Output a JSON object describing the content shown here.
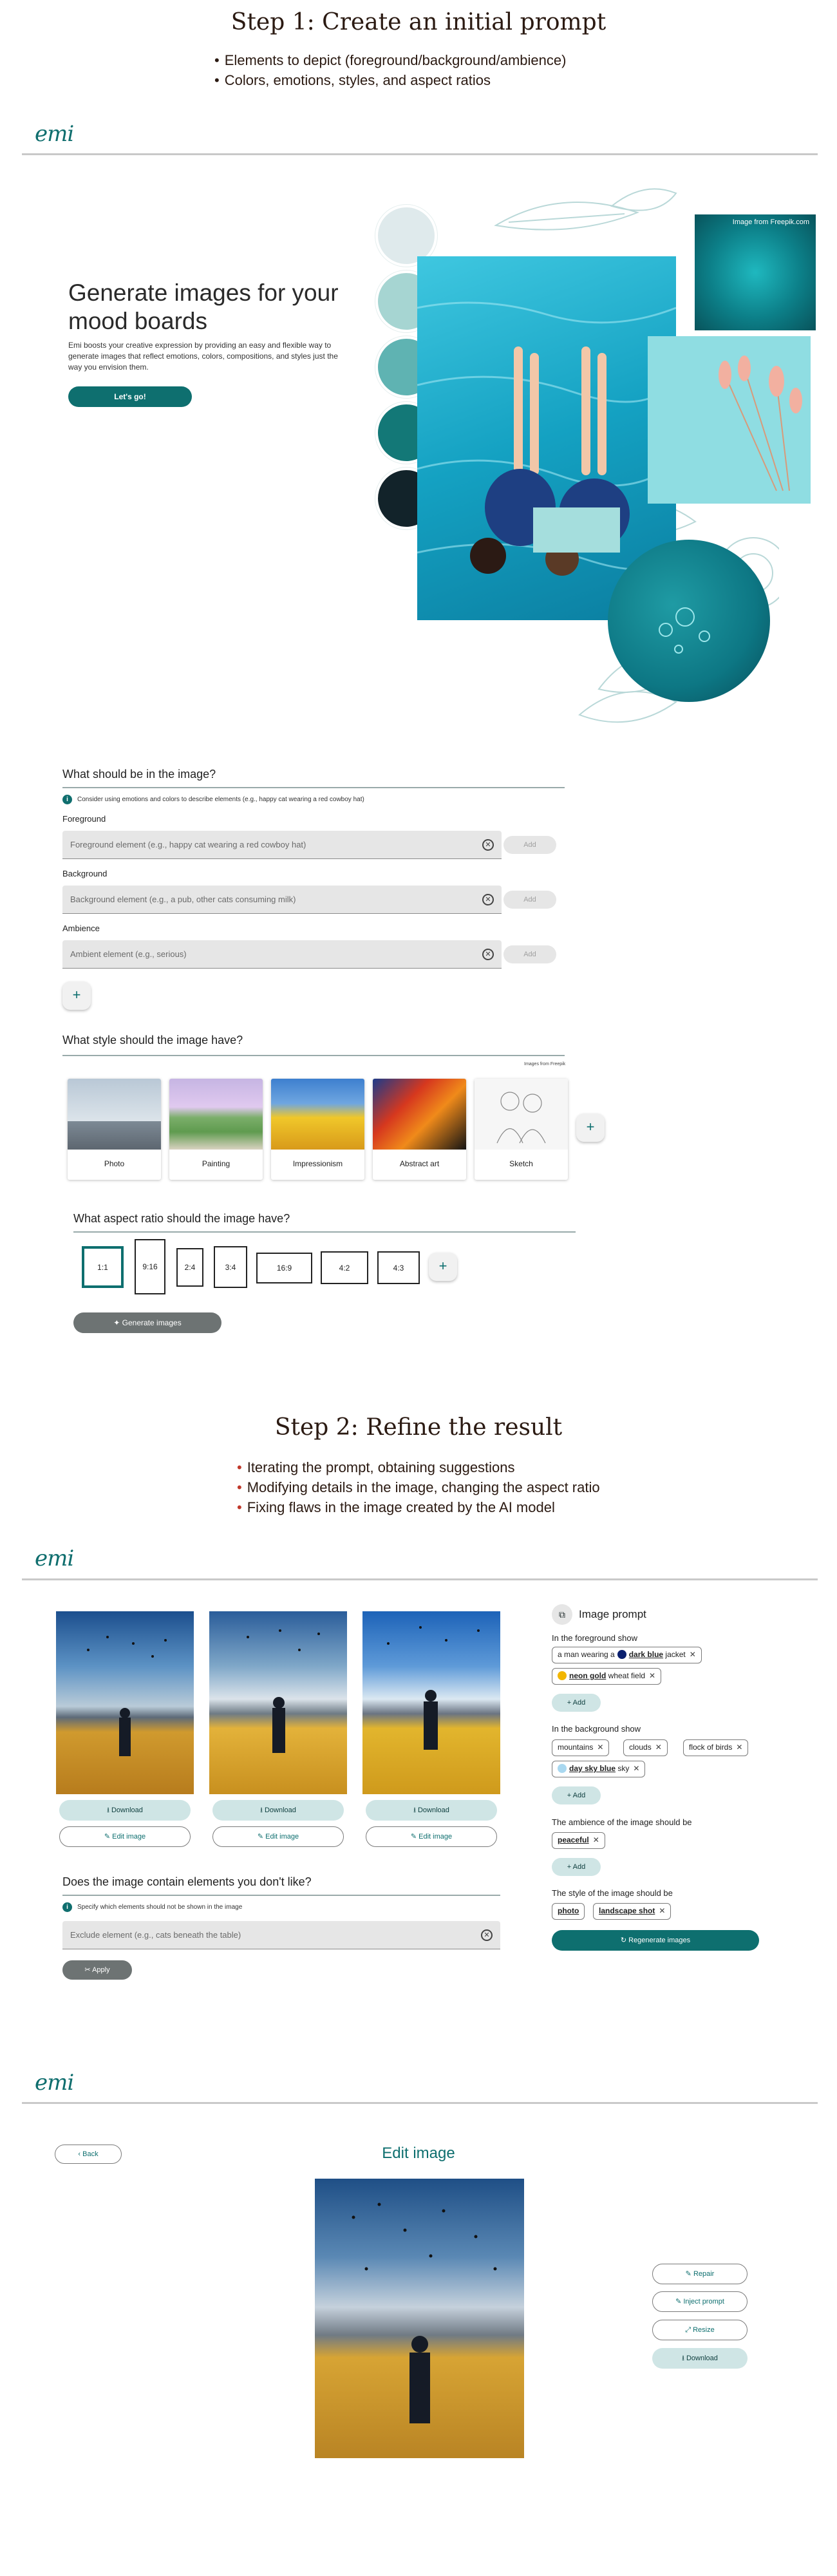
{
  "step1": {
    "title": "Step 1: Create an initial prompt",
    "bullets": [
      "Elements to depict (foreground/background/ambience)",
      "Colors, emotions, styles, and aspect ratios"
    ]
  },
  "step2": {
    "title": "Step 2: Refine the result",
    "bullets": [
      "Iterating the prompt, obtaining suggestions",
      "Modifying details in the image, changing the aspect ratio",
      "Fixing flaws in the image created by the AI model"
    ]
  },
  "logo": "emi",
  "hero": {
    "title": "Generate images for your mood boards",
    "description": "Emi boosts your creative expression by providing an easy and flexible way to generate images that reflect emotions, colors, compositions, and styles just the way you envision them.",
    "cta": "Let's go!",
    "credit": "Image from Freepik.com",
    "swatches": [
      "#dfeaec",
      "#a6d5d2",
      "#5fb3b2",
      "#137877",
      "#12232a"
    ]
  },
  "prompt_form": {
    "title": "What should be in the image?",
    "hint": "Consider using emotions and colors to describe elements (e.g., happy cat wearing a red cowboy hat)",
    "foreground_label": "Foreground",
    "foreground_placeholder": "Foreground element (e.g., happy cat wearing a red cowboy hat)",
    "background_label": "Background",
    "background_placeholder": "Background element (e.g., a pub, other cats consuming milk)",
    "ambience_label": "Ambience",
    "ambience_placeholder": "Ambient element (e.g., serious)",
    "add_label": "Add",
    "plus": "+"
  },
  "style_form": {
    "title": "What style should the image have?",
    "credit": "Images from Freepik",
    "styles": [
      "Photo",
      "Painting",
      "Impressionism",
      "Abstract art",
      "Sketch"
    ]
  },
  "ratio_form": {
    "title": "What aspect ratio should the image have?",
    "ratios": [
      "1:1",
      "9:16",
      "2:4",
      "3:4",
      "16:9",
      "4:2",
      "4:3"
    ],
    "generate": "Generate images"
  },
  "results": {
    "download": "Download",
    "edit": "Edit image",
    "exclude_title": "Does the image contain elements you don't like?",
    "exclude_hint": "Specify which elements should not be shown in the image",
    "exclude_placeholder": "Exclude element (e.g., cats beneath the table)",
    "apply": "Apply"
  },
  "prompt_panel": {
    "title": "Image prompt",
    "foreground_label": "In the foreground show",
    "fg_chip1_a": "a man wearing a",
    "fg_chip1_b": "dark blue",
    "fg_chip1_c": "jacket",
    "fg_chip2_b": "neon gold",
    "fg_chip2_c": "wheat field",
    "background_label": "In the background show",
    "bg_chips": [
      "mountains",
      "clouds",
      "flock of birds"
    ],
    "bg_chip4_b": "day sky blue",
    "bg_chip4_c": "sky",
    "ambience_label": "The ambience of the image should be",
    "ambience_chip": "peaceful",
    "style_label": "The style of the image should be",
    "style_chips": [
      "photo",
      "landscape shot"
    ],
    "add": "Add",
    "regenerate": "Regenerate images",
    "colors": {
      "dark_blue": "#0a1f6e",
      "neon_gold": "#f2b600",
      "day_sky_blue": "#a9d8f0"
    }
  },
  "edit_page": {
    "back": "Back",
    "title": "Edit image",
    "actions": [
      "Repair",
      "Inject prompt",
      "Resize"
    ],
    "download": "Download"
  }
}
